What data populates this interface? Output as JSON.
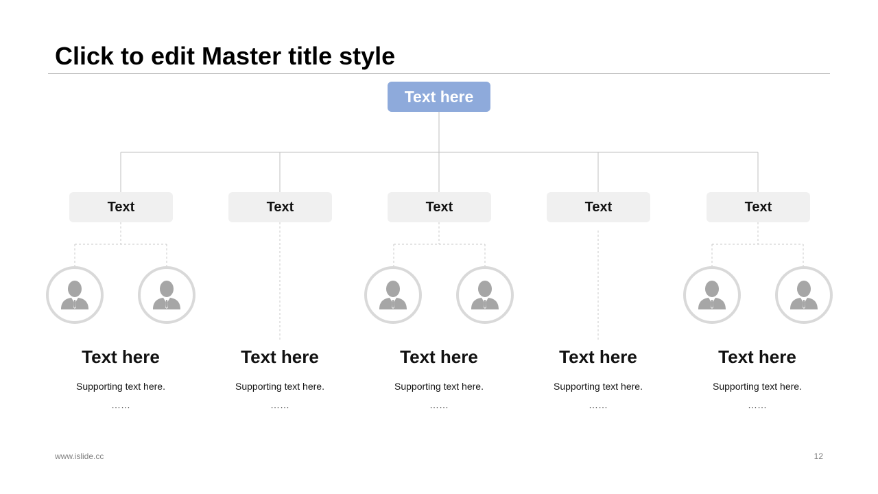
{
  "slide": {
    "title": "Click to edit Master title style",
    "footer_site": "www.islide.cc",
    "page_number": "12"
  },
  "colors": {
    "root_fill": "#8eaadb",
    "branch_fill": "#f0f0f0",
    "connector": "#bfbfbf",
    "avatar_ring": "#d9d9d9",
    "avatar_figure": "#a6a6a6"
  },
  "org_chart": {
    "root": {
      "label": "Text here"
    },
    "branches": [
      {
        "label": "Text",
        "avatars": 2,
        "heading": "Text here",
        "support": "Supporting text here.",
        "ellipsis": "……"
      },
      {
        "label": "Text",
        "avatars": 0,
        "heading": "Text here",
        "support": "Supporting text here.",
        "ellipsis": "……"
      },
      {
        "label": "Text",
        "avatars": 2,
        "heading": "Text here",
        "support": "Supporting text here.",
        "ellipsis": "……"
      },
      {
        "label": "Text",
        "avatars": 0,
        "heading": "Text here",
        "support": "Supporting text here.",
        "ellipsis": "……"
      },
      {
        "label": "Text",
        "avatars": 2,
        "heading": "Text here",
        "support": "Supporting text here.",
        "ellipsis": "……"
      }
    ],
    "avatar_icon": "person-icon"
  }
}
